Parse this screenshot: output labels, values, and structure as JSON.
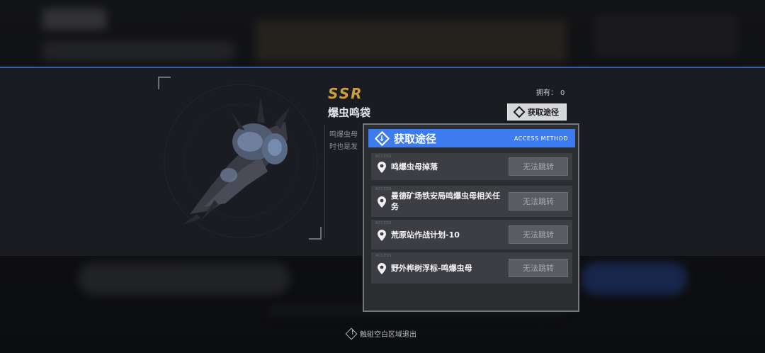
{
  "item": {
    "rarity": "SSR",
    "name": "爆虫鸣袋",
    "description": "鸣爆虫母 时也是发",
    "owned_label": "拥有：",
    "owned_count": "0",
    "acquire_button_label": "获取途径",
    "art_icon": "bug-sac-art"
  },
  "popup": {
    "title": "获取途径",
    "subtitle": "ACCESS METHOD",
    "accent_color": "#3d7bf0",
    "rows": [
      {
        "tag": "ACCESS",
        "label": "鸣爆虫母掉落",
        "button": "无法跳转"
      },
      {
        "tag": "ACCESS",
        "label": "曼德矿场铁安局鸣爆虫母相关任务",
        "button": "无法跳转"
      },
      {
        "tag": "ACCESS",
        "label": "荒原站作战计划-10",
        "button": "无法跳转"
      },
      {
        "tag": "ACCESS",
        "label": "野外桦树浮标-鸣爆虫母",
        "button": "无法跳转"
      }
    ]
  },
  "footer": {
    "exit_hint": "触碰空白区域退出"
  },
  "colors": {
    "rarity_gold": "#c9a03f",
    "band_border": "#3a5ea6"
  }
}
